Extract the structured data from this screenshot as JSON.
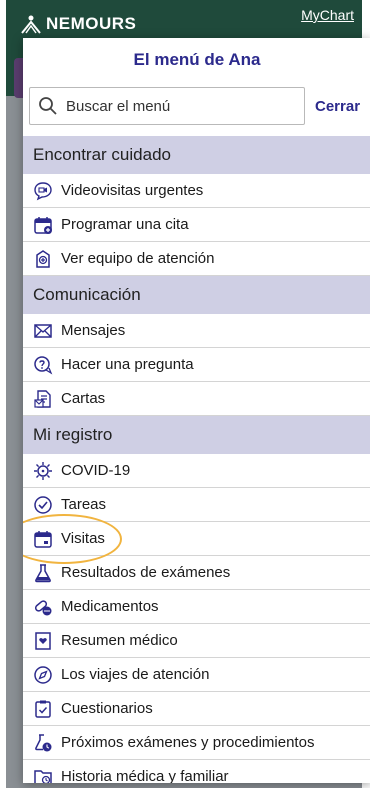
{
  "background": {
    "logo_text": "NEMOURS",
    "mychart_label": "MyChart"
  },
  "menu": {
    "title": "El menú de Ana",
    "search": {
      "placeholder": "Buscar el menú"
    },
    "close_label": "Cerrar",
    "sections": [
      {
        "header": "Encontrar cuidado",
        "items": [
          {
            "label": "Videovisitas urgentes",
            "icon": "video-chat-icon"
          },
          {
            "label": "Programar una cita",
            "icon": "calendar-add-icon"
          },
          {
            "label": "Ver equipo de atención",
            "icon": "care-team-icon"
          }
        ]
      },
      {
        "header": "Comunicación",
        "items": [
          {
            "label": "Mensajes",
            "icon": "envelope-icon"
          },
          {
            "label": "Hacer una pregunta",
            "icon": "question-bubble-icon"
          },
          {
            "label": "Cartas",
            "icon": "letters-icon"
          }
        ]
      },
      {
        "header": "Mi registro",
        "items": [
          {
            "label": "COVID-19",
            "icon": "virus-icon"
          },
          {
            "label": "Tareas",
            "icon": "tasks-icon"
          },
          {
            "label": "Visitas",
            "icon": "calendar-icon",
            "highlighted": true
          },
          {
            "label": "Resultados de exámenes",
            "icon": "flask-icon"
          },
          {
            "label": "Medicamentos",
            "icon": "pills-icon"
          },
          {
            "label": "Resumen médico",
            "icon": "medical-summary-icon"
          },
          {
            "label": "Los viajes de atención",
            "icon": "compass-icon"
          },
          {
            "label": "Cuestionarios",
            "icon": "clipboard-check-icon"
          },
          {
            "label": "Próximos exámenes y procedimientos",
            "icon": "upcoming-tests-icon"
          },
          {
            "label": "Historia médica y familiar",
            "icon": "history-folder-icon"
          }
        ]
      }
    ]
  },
  "colors": {
    "accent": "#2c2a8c",
    "section_bg": "#cfcfe4",
    "highlight": "#f1b43f",
    "header_green": "#1f4a3b"
  }
}
